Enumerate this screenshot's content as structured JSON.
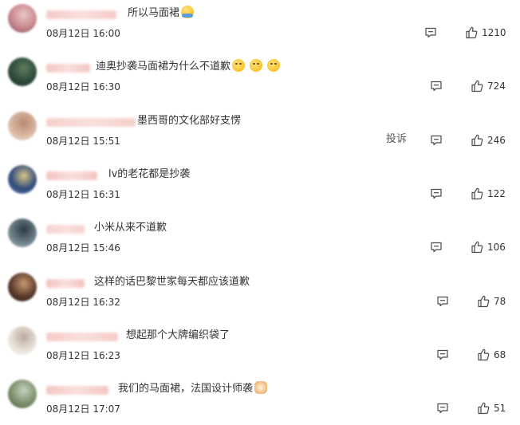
{
  "comments": [
    {
      "text": "所以马面裙",
      "emoji": "hug",
      "emoji_count": 1,
      "time": "08月12日 16:00",
      "likes": "1210",
      "report": "",
      "avatar_colors": [
        "#c9868c",
        "#e8c8c6",
        "#6a4b57"
      ],
      "name_color": "#f2b8b4"
    },
    {
      "text": "迪奥抄袭马面裙为什么不道歉",
      "emoji": "face",
      "emoji_count": 3,
      "time": "08月12日 16:30",
      "likes": "724",
      "report": "",
      "avatar_colors": [
        "#2d4a3a",
        "#5c7d5c",
        "#1a2a24"
      ],
      "name_color": "#f0b3ae"
    },
    {
      "text": "墨西哥的文化部好支愣",
      "emoji": "",
      "emoji_count": 0,
      "time": "08月12日 15:51",
      "likes": "246",
      "report": "投诉",
      "avatar_colors": [
        "#d9b7a2",
        "#b88a72",
        "#f0e0d3"
      ],
      "name_color": "#f3bfb8"
    },
    {
      "text": "lv的老花都是抄袭",
      "emoji": "",
      "emoji_count": 0,
      "time": "08月12日 16:31",
      "likes": "122",
      "report": "",
      "avatar_colors": [
        "#2f4a7a",
        "#d8c58a",
        "#6a86b8"
      ],
      "name_color": "#efb0ab"
    },
    {
      "text": "小米从来不道歉",
      "emoji": "",
      "emoji_count": 0,
      "time": "08月12日 15:46",
      "likes": "106",
      "report": "",
      "avatar_colors": [
        "#6c7e88",
        "#2c3a42",
        "#a9b8bf"
      ],
      "name_color": "#f3c2bd"
    },
    {
      "text": "这样的话巴黎世家每天都应该道歉",
      "emoji": "",
      "emoji_count": 0,
      "time": "08月12日 16:32",
      "likes": "78",
      "report": "",
      "avatar_colors": [
        "#5a3a2a",
        "#c79a72",
        "#2a1a12"
      ],
      "name_color": "#f0aea8"
    },
    {
      "text": "想起那个大牌编织袋了",
      "emoji": "",
      "emoji_count": 0,
      "time": "08月12日 16:23",
      "likes": "68",
      "report": "",
      "avatar_colors": [
        "#e9e2da",
        "#b9a89a",
        "#f6f2ee"
      ],
      "name_color": "#f2b9b3"
    },
    {
      "text": "我们的马面裙，法国设计师袭",
      "emoji": "cat",
      "emoji_count": 1,
      "time": "08月12日 17:07",
      "likes": "51",
      "report": "",
      "avatar_colors": [
        "#7a8f6a",
        "#c9d2c0",
        "#3f5a3a"
      ],
      "name_color": "#f0b2ac"
    }
  ]
}
